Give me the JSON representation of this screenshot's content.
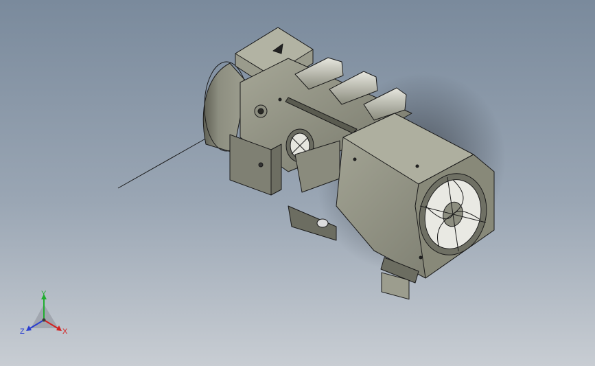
{
  "triad": {
    "x_label": "X",
    "y_label": "Y",
    "z_label": "Z",
    "x_color": "#d42020",
    "y_color": "#1fae2f",
    "z_color": "#2a3ed0"
  },
  "model": {
    "body_color": "#8d8e80",
    "shadow_color": "#6d6e62",
    "highlight_color": "#b9baa9",
    "edge_color": "#1a1a1a"
  },
  "background": {
    "top": "#7a8a9c",
    "bottom": "#c8cdd3"
  }
}
